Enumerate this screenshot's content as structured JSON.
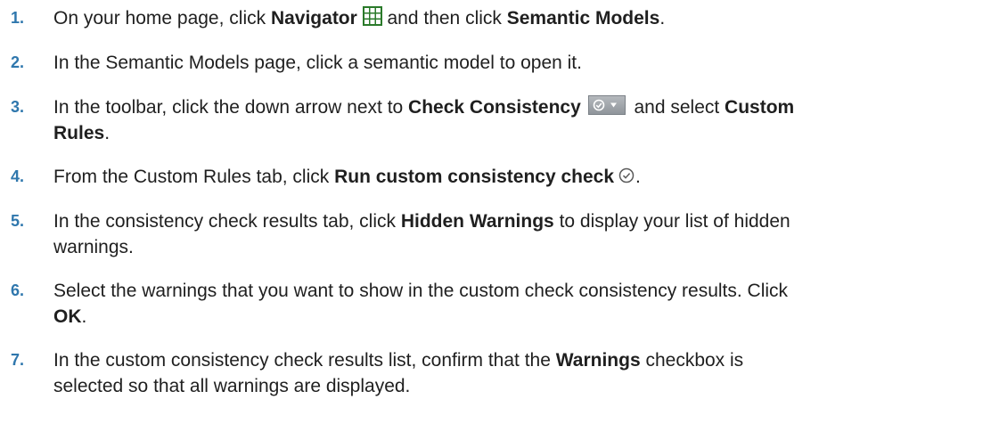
{
  "steps": [
    {
      "num": "1.",
      "parts": [
        "On your home page, click ",
        "Navigator",
        " and then click ",
        "Semantic Models",
        "."
      ],
      "icon": "navigator-grid-icon"
    },
    {
      "num": "2.",
      "parts": [
        "In the Semantic Models page, click a semantic model to open it."
      ]
    },
    {
      "num": "3.",
      "parts": [
        "In the toolbar, click the down arrow next to ",
        "Check Consistency",
        " and select ",
        "Custom",
        "Rules",
        "."
      ],
      "icon": "check-consistency-dropdown-icon"
    },
    {
      "num": "4.",
      "parts": [
        "From the Custom Rules tab, click ",
        "Run custom consistency check",
        "."
      ],
      "icon": "run-check-icon"
    },
    {
      "num": "5.",
      "parts": [
        "In the consistency check results tab, click ",
        "Hidden Warnings",
        " to display your list of hidden",
        "warnings."
      ]
    },
    {
      "num": "6.",
      "parts": [
        "Select the warnings that you want to show in the custom check consistency results. Click",
        "OK",
        "."
      ]
    },
    {
      "num": "7.",
      "parts": [
        "In the custom consistency check results list, confirm that the ",
        "Warnings",
        " checkbox is",
        "selected so that all warnings are displayed."
      ]
    }
  ],
  "colors": {
    "step_number": "#2f77ad",
    "text": "#1f1f1f",
    "navigator_icon": "#2a7a2a"
  }
}
